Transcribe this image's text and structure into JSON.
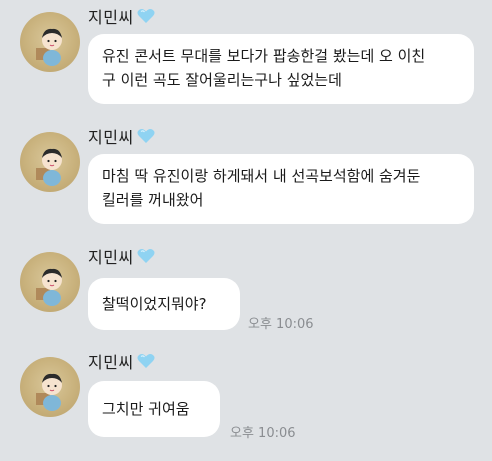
{
  "messages": [
    {
      "sender": "지민씨",
      "text": "유진 콘서트 무대를 보다가 팝송한걸 봤는데 오 이친\n구 이런 곡도 잘어울리는구나 싶었는데",
      "time": ""
    },
    {
      "sender": "지민씨",
      "text": "마침 딱 유진이랑 하게돼서 내 선곡보석함에 숨겨둔\n킬러를 꺼내왔어",
      "time": ""
    },
    {
      "sender": "지민씨",
      "text": "찰떡이었지뭐야?",
      "time": "오후 10:06"
    },
    {
      "sender": "지민씨",
      "text": "그치만 귀여움",
      "time": "오후 10:06"
    }
  ],
  "icons": {
    "heart": "light-blue-heart-emoji",
    "avatar": "cartoon-baby-avatar"
  },
  "colors": {
    "background": "#dfe2e5",
    "bubble": "#ffffff",
    "heart": "#8fd3f2",
    "time": "#8a8d91"
  }
}
